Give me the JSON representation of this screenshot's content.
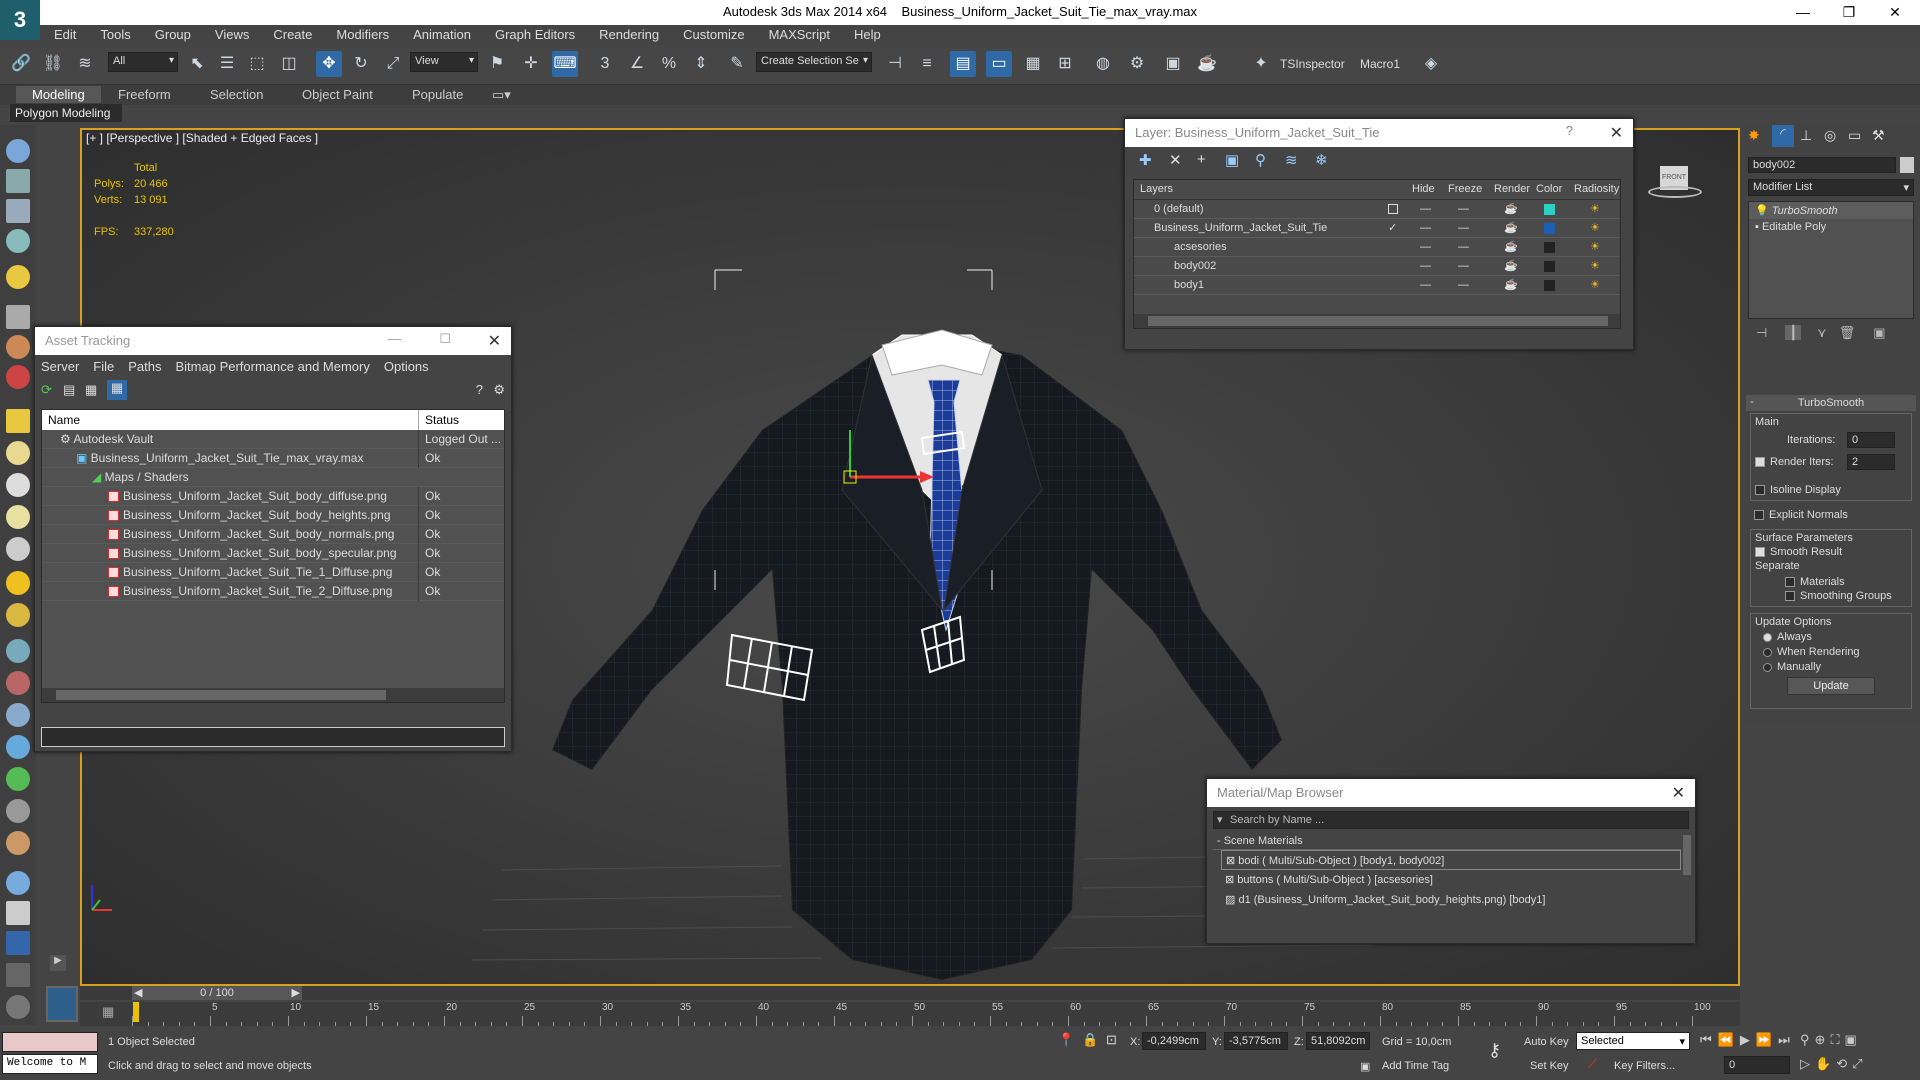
{
  "app": {
    "title": "Autodesk 3ds Max 2014 x64",
    "file": "Business_Uniform_Jacket_Suit_Tie_max_vray.max",
    "logo": "3"
  },
  "menu": [
    "Edit",
    "Tools",
    "Group",
    "Views",
    "Create",
    "Modifiers",
    "Animation",
    "Graph Editors",
    "Rendering",
    "Customize",
    "MAXScript",
    "Help"
  ],
  "toolbar": {
    "filter": "All",
    "refcoord": "View",
    "selection_set": "Create Selection Se",
    "tsinspector": "TSInspector",
    "macro": "Macro1"
  },
  "ribbon": {
    "tabs": [
      "Modeling",
      "Freeform",
      "Selection",
      "Object Paint",
      "Populate"
    ],
    "active": "Modeling",
    "panel": "Polygon Modeling"
  },
  "viewport": {
    "label": "[+ ] [Perspective ] [Shaded + Edged Faces ]",
    "stats_header": "Total",
    "polys_label": "Polys:",
    "polys": "20 466",
    "verts_label": "Verts:",
    "verts": "13 091",
    "fps_label": "FPS:",
    "fps": "337,280",
    "viewcube": "FRONT"
  },
  "asset_tracking": {
    "title": "Asset Tracking",
    "menu": [
      "Server",
      "File",
      "Paths",
      "Bitmap Performance and Memory",
      "Options"
    ],
    "col_name": "Name",
    "col_status": "Status",
    "rows": [
      {
        "name": "Autodesk Vault",
        "status": "Logged Out ..."
      },
      {
        "name": "Business_Uniform_Jacket_Suit_Tie_max_vray.max",
        "status": "Ok"
      },
      {
        "name": "Maps / Shaders",
        "status": ""
      },
      {
        "name": "Business_Uniform_Jacket_Suit_body_diffuse.png",
        "status": "Ok"
      },
      {
        "name": "Business_Uniform_Jacket_Suit_body_heights.png",
        "status": "Ok"
      },
      {
        "name": "Business_Uniform_Jacket_Suit_body_normals.png",
        "status": "Ok"
      },
      {
        "name": "Business_Uniform_Jacket_Suit_body_specular.png",
        "status": "Ok"
      },
      {
        "name": "Business_Uniform_Jacket_Suit_Tie_1_Diffuse.png",
        "status": "Ok"
      },
      {
        "name": "Business_Uniform_Jacket_Suit_Tie_2_Diffuse.png",
        "status": "Ok"
      }
    ]
  },
  "layer": {
    "title": "Layer: Business_Uniform_Jacket_Suit_Tie",
    "cols": [
      "Layers",
      "Hide",
      "Freeze",
      "Render",
      "Color",
      "Radiosity"
    ],
    "rows": [
      {
        "name": "0 (default)",
        "color": "#2ad1c4"
      },
      {
        "name": "Business_Uniform_Jacket_Suit_Tie",
        "color": "#1d5fb0"
      },
      {
        "name": "acsesories",
        "color": "#222222"
      },
      {
        "name": "body002",
        "color": "#222222"
      },
      {
        "name": "body1",
        "color": "#222222"
      }
    ]
  },
  "material_browser": {
    "title": "Material/Map Browser",
    "search_placeholder": "Search by Name ...",
    "group": "- Scene Materials",
    "items": [
      "bodi  ( Multi/Sub-Object )  [body1, body002]",
      "buttons  ( Multi/Sub-Object )  [acsesories]",
      "d1 (Business_Uniform_Jacket_Suit_body_heights.png) [body1]"
    ]
  },
  "command_panel": {
    "object_name": "body002",
    "modifier_list": "Modifier List",
    "stack": [
      "TurboSmooth",
      "Editable Poly"
    ],
    "rollout_title": "TurboSmooth",
    "main": "Main",
    "iterations_label": "Iterations:",
    "iterations": "0",
    "render_iters_label": "Render Iters:",
    "render_iters": "2",
    "isoline": "Isoline Display",
    "explicit": "Explicit Normals",
    "surface": "Surface Parameters",
    "smooth": "Smooth Result",
    "separate": "Separate",
    "materials": "Materials",
    "smoothing": "Smoothing Groups",
    "update_options": "Update Options",
    "always": "Always",
    "when_rendering": "When Rendering",
    "manually": "Manually",
    "update": "Update"
  },
  "timeline": {
    "frame": "0 / 100",
    "ticks": [
      "0",
      "5",
      "10",
      "15",
      "20",
      "25",
      "30",
      "35",
      "40",
      "45",
      "50",
      "55",
      "60",
      "65",
      "70",
      "75",
      "80",
      "85",
      "90",
      "95",
      "100"
    ]
  },
  "status": {
    "selected": "1 Object Selected",
    "prompt": "Click and drag to select and move objects",
    "welcome": "Welcome to M",
    "x_label": "X:",
    "x": "-0,2499cm",
    "y_label": "Y:",
    "y": "-3,5775cm",
    "z_label": "Z:",
    "z": "51,8092cm",
    "grid": "Grid = 10,0cm",
    "add_time_tag": "Add Time Tag",
    "auto_key": "Auto Key",
    "set_key": "Set Key",
    "key_mode": "Selected",
    "key_filters": "Key Filters...",
    "frame_field": "0"
  }
}
